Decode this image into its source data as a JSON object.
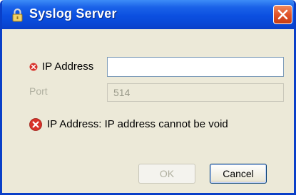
{
  "window": {
    "title": "Syslog Server"
  },
  "form": {
    "ip_label": "IP Address",
    "ip_value": "",
    "port_label": "Port",
    "port_value": "514"
  },
  "error": {
    "message": "IP Address: IP address cannot be void"
  },
  "buttons": {
    "ok": "OK",
    "cancel": "Cancel"
  },
  "icons": {
    "title": "lock-icon",
    "close": "close-icon",
    "field_error": "error-icon",
    "message_error": "error-icon"
  },
  "colors": {
    "titlebar": "#0a48d6",
    "dialog_bg": "#ece9d8",
    "error_red": "#d8322a",
    "close_button": "#e0542a"
  }
}
